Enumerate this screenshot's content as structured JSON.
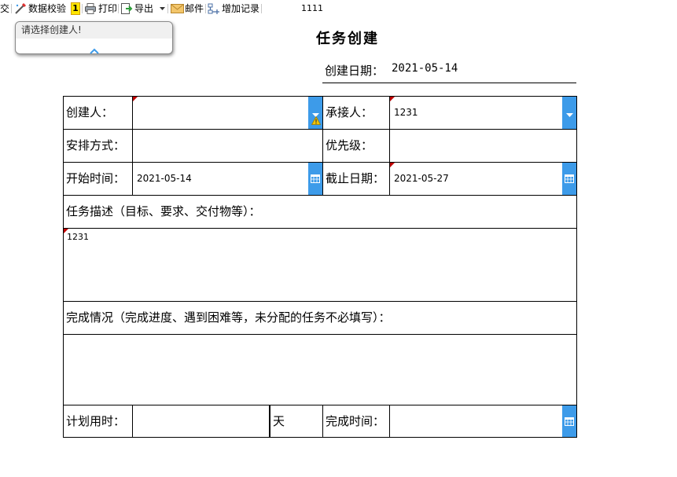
{
  "toolbar": {
    "submit_label": "提交",
    "validate_label": "数据校验",
    "validate_badge": "1",
    "print_label": "打印",
    "export_label": "导出",
    "mail_label": "邮件",
    "add_record_label": "增加记录",
    "extra_text": "1111"
  },
  "tooltip": {
    "message": "请选择创建人!"
  },
  "form": {
    "title": "任务创建",
    "create_date_label": "创建日期：",
    "create_date_value": "2021-05-14",
    "creator_label": "创建人：",
    "creator_value": "",
    "assignee_label": "承接人：",
    "assignee_value": "1231",
    "arrangement_label": "安排方式：",
    "arrangement_value": "",
    "priority_label": "优先级：",
    "priority_value": "",
    "start_time_label": "开始时间：",
    "start_time_value": "2021-05-14",
    "deadline_label": "截止日期：",
    "deadline_value": "2021-05-27",
    "description_label": "任务描述（目标、要求、交付物等）：",
    "description_value": "1231",
    "completion_label": "完成情况（完成进度、遇到困难等，未分配的任务不必填写）：",
    "completion_value": "",
    "planned_time_label": "计划用时：",
    "planned_time_value": "",
    "planned_time_unit": "天",
    "finish_time_label": "完成时间：",
    "finish_time_value": ""
  },
  "colors": {
    "button_blue": "#3d9be9",
    "required_marker": "#c00000",
    "warning_yellow": "#f5c400"
  },
  "icons": [
    "submit-icon",
    "validate-icon",
    "print-icon",
    "export-icon",
    "chevron-down-icon",
    "mail-icon",
    "add-record-icon",
    "chevron-up-icon",
    "dropdown-arrow-icon",
    "warning-icon",
    "calendar-icon"
  ]
}
